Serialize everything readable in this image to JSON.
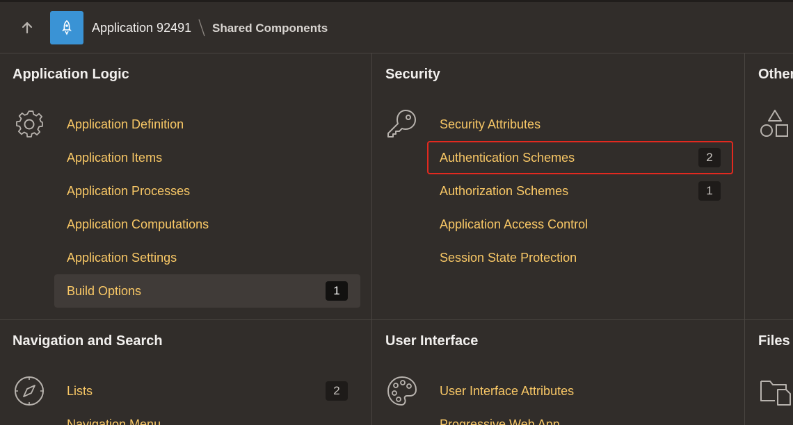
{
  "header": {
    "app_name": "Application 92491",
    "current_page": "Shared Components",
    "up_icon": "arrow-up-icon",
    "app_icon": "rocket-icon",
    "separator_icon": "breadcrumb-separator-icon"
  },
  "colors": {
    "background": "#312d2a",
    "link": "#f9c866",
    "app_tile": "#3a93d5",
    "selection_outline": "#e2291f",
    "badge_bg": "#1e1b19"
  },
  "sections": {
    "application_logic": {
      "title": "Application Logic",
      "icon": "gear-icon",
      "items": [
        {
          "label": "Application Definition",
          "count": null
        },
        {
          "label": "Application Items",
          "count": null
        },
        {
          "label": "Application Processes",
          "count": null
        },
        {
          "label": "Application Computations",
          "count": null
        },
        {
          "label": "Application Settings",
          "count": null
        },
        {
          "label": "Build Options",
          "count": "1",
          "state": "hovered"
        }
      ]
    },
    "security": {
      "title": "Security",
      "icon": "key-icon",
      "items": [
        {
          "label": "Security Attributes",
          "count": null
        },
        {
          "label": "Authentication Schemes",
          "count": "2",
          "state": "selected"
        },
        {
          "label": "Authorization Schemes",
          "count": "1"
        },
        {
          "label": "Application Access Control",
          "count": null
        },
        {
          "label": "Session State Protection",
          "count": null
        }
      ]
    },
    "other": {
      "title": "Other",
      "icon": "shapes-icon"
    },
    "navigation_and_search": {
      "title": "Navigation and Search",
      "icon": "compass-icon",
      "items": [
        {
          "label": "Lists",
          "count": "2"
        },
        {
          "label": "Navigation Menu",
          "count": null
        }
      ]
    },
    "user_interface": {
      "title": "User Interface",
      "icon": "palette-icon",
      "items": [
        {
          "label": "User Interface Attributes",
          "count": null
        },
        {
          "label": "Progressive Web App",
          "count": null
        }
      ]
    },
    "files": {
      "title": "Files",
      "icon": "folder-file-icon"
    }
  }
}
